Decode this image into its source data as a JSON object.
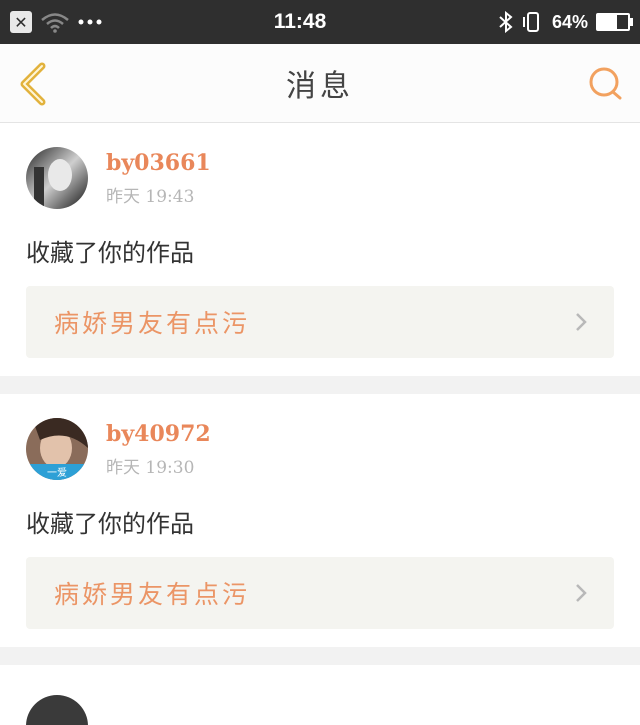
{
  "status": {
    "time": "11:48",
    "battery": "64%",
    "battery_level": 0.64
  },
  "header": {
    "title": "消息"
  },
  "messages": [
    {
      "user": "by03661",
      "time": "昨天 19:43",
      "text": "收藏了你的作品",
      "work": "病娇男友有点污"
    },
    {
      "user": "by40972",
      "time": "昨天 19:30",
      "text": "收藏了你的作品",
      "work": "病娇男友有点污",
      "avatar_badge": "一爱"
    }
  ],
  "colors": {
    "accent": "#e9875a",
    "status_bar": "#2f2f2f"
  }
}
